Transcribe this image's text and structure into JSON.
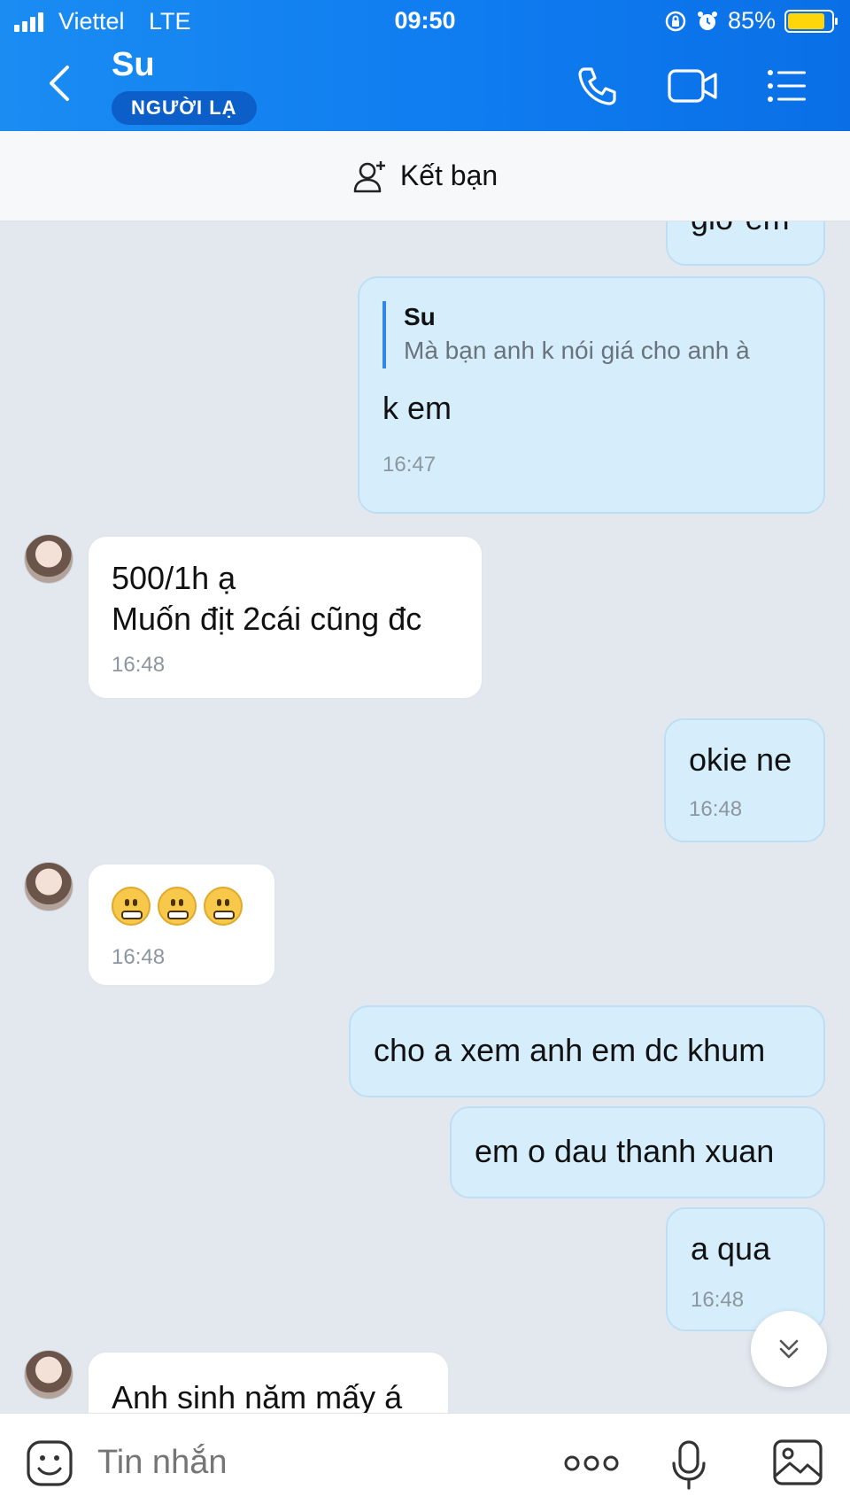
{
  "status_bar": {
    "carrier": "Viettel",
    "network": "LTE",
    "time": "09:50",
    "battery": "85%",
    "battery_level": 0.85
  },
  "header": {
    "contact_name": "Su",
    "badge": "NGƯỜI LẠ",
    "back_icon": "chevron-left-icon",
    "actions": [
      "phone-icon",
      "video-call-icon",
      "menu-list-icon"
    ]
  },
  "friend_bar": {
    "icon": "add-friend-icon",
    "label": "Kết bạn"
  },
  "messages": [
    {
      "side": "out",
      "text": "giờ em"
    },
    {
      "side": "out",
      "quote_name": "Su",
      "quote_text": "Mà bạn anh k nói giá cho anh à",
      "text": "k em",
      "time": "16:47"
    },
    {
      "side": "in",
      "line1": "500/1h ạ",
      "line2": "Muốn địt 2cái cũng đc",
      "time": "16:48"
    },
    {
      "side": "out",
      "text": "okie ne",
      "time": "16:48"
    },
    {
      "side": "in",
      "emoji": "grimacing-face",
      "emoji_count": 3,
      "time": "16:48"
    },
    {
      "side": "out",
      "text": "cho a xem anh em dc khum"
    },
    {
      "side": "out",
      "text": "em o dau thanh xuan"
    },
    {
      "side": "out",
      "text": "a qua",
      "time": "16:48"
    },
    {
      "side": "in",
      "text": "Anh sinh năm mấy á"
    }
  ],
  "composer": {
    "placeholder": "Tin nhắn",
    "icons": [
      "sticker-icon",
      "more-options-icon",
      "microphone-icon",
      "image-icon"
    ]
  },
  "colors": {
    "header_blue": "#0f7cf0",
    "outgoing_bubble": "#d6eefc",
    "incoming_bubble": "#ffffff",
    "chat_background": "#e3e8ef"
  }
}
